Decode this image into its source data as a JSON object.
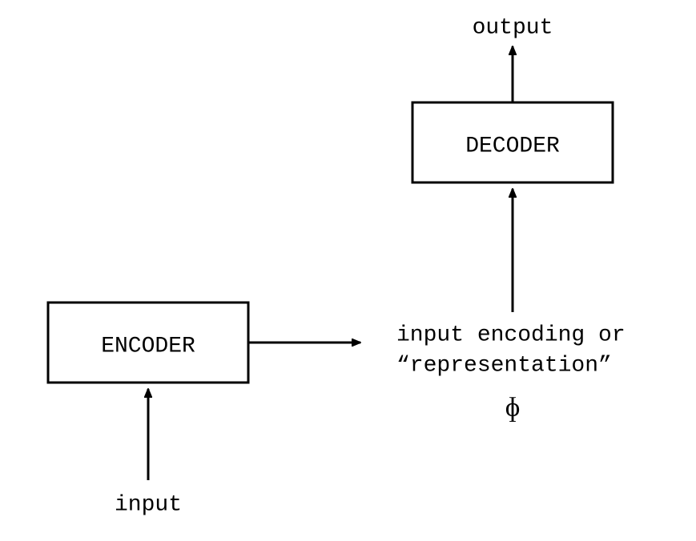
{
  "diagram": {
    "encoder_box_label": "ENCODER",
    "decoder_box_label": "DECODER",
    "input_label": "input",
    "output_label": "output",
    "representation_line1": "input encoding or",
    "representation_line2": "“representation”",
    "phi_symbol": "ɸ"
  }
}
